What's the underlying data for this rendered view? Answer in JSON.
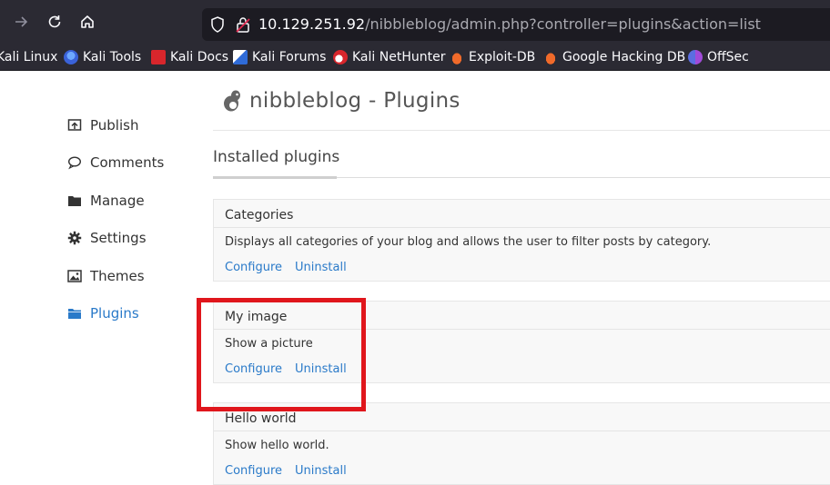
{
  "browser": {
    "url_host": "10.129.251.92",
    "url_path": "/nibbleblog/admin.php?controller=plugins&action=list",
    "bookmarks": [
      {
        "label": "Kali Linux",
        "icon": "kali-icon"
      },
      {
        "label": "Kali Tools",
        "icon": "kali-tools-icon"
      },
      {
        "label": "Kali Docs",
        "icon": "kali-docs-icon"
      },
      {
        "label": "Kali Forums",
        "icon": "kali-forums-icon"
      },
      {
        "label": "Kali NetHunter",
        "icon": "nethunter-icon"
      },
      {
        "label": "Exploit-DB",
        "icon": "exploit-db-icon"
      },
      {
        "label": "Google Hacking DB",
        "icon": "ghdb-icon"
      },
      {
        "label": "OffSec",
        "icon": "offsec-icon"
      }
    ]
  },
  "sidebar": {
    "items": [
      {
        "label": "Publish",
        "icon": "publish-icon"
      },
      {
        "label": "Comments",
        "icon": "comment-icon"
      },
      {
        "label": "Manage",
        "icon": "folder-icon"
      },
      {
        "label": "Settings",
        "icon": "gear-icon"
      },
      {
        "label": "Themes",
        "icon": "image-icon"
      },
      {
        "label": "Plugins",
        "icon": "folder-open-icon",
        "active": true
      }
    ]
  },
  "header": {
    "title": "nibbleblog - Plugins"
  },
  "main": {
    "section_title": "Installed plugins",
    "plugins": [
      {
        "name": "Categories",
        "description": "Displays all categories of your blog and allows the user to filter posts by category.",
        "configure": "Configure",
        "uninstall": "Uninstall"
      },
      {
        "name": "My image",
        "description": "Show a picture",
        "configure": "Configure",
        "uninstall": "Uninstall"
      },
      {
        "name": "Hello world",
        "description": "Show hello world.",
        "configure": "Configure",
        "uninstall": "Uninstall"
      }
    ]
  },
  "colors": {
    "accent": "#2a7ac9",
    "highlight": "#e0161c",
    "chrome": "#2b2a33"
  }
}
